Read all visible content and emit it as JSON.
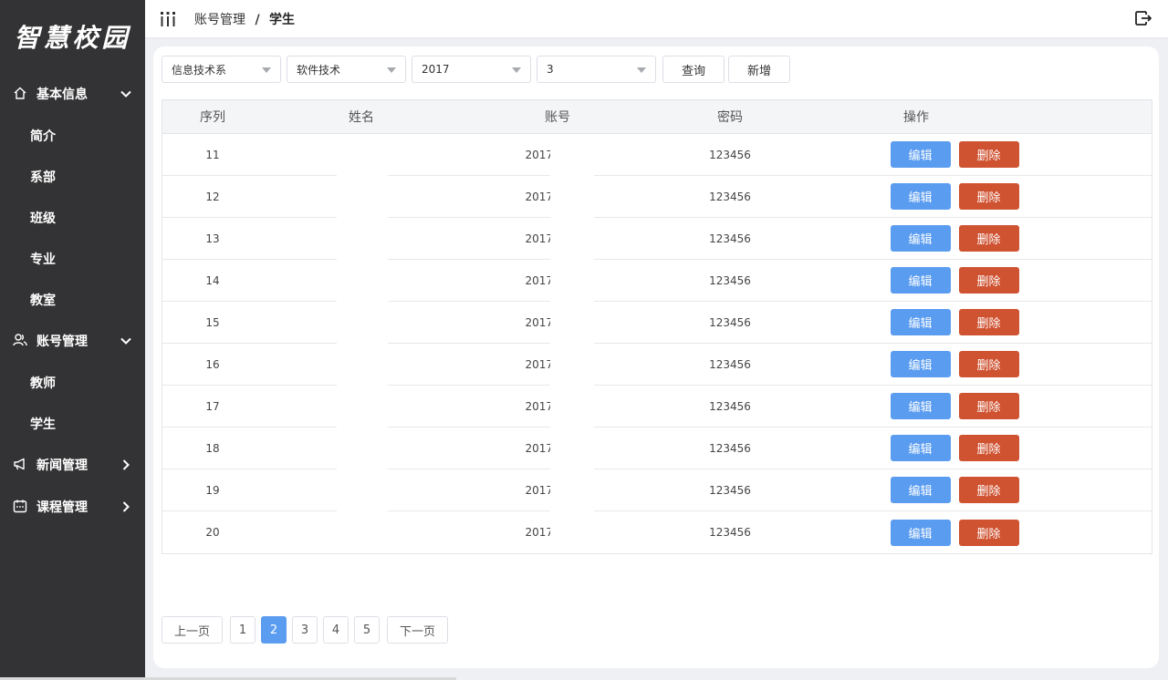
{
  "brand": {
    "logo_text": "智慧校园"
  },
  "sidebar": {
    "groups": [
      {
        "label": "基本信息",
        "icon": "home-icon",
        "expanded": true,
        "items": [
          "简介",
          "系部",
          "班级",
          "专业",
          "教室"
        ]
      },
      {
        "label": "账号管理",
        "icon": "users-icon",
        "expanded": true,
        "items": [
          "教师",
          "学生"
        ]
      },
      {
        "label": "新闻管理",
        "icon": "megaphone-icon",
        "expanded": false,
        "items": []
      },
      {
        "label": "课程管理",
        "icon": "calendar-icon",
        "expanded": false,
        "items": []
      }
    ]
  },
  "header": {
    "breadcrumb_parent": "账号管理",
    "breadcrumb_sep": "/",
    "breadcrumb_current": "学生",
    "menu_icon": "menu-icon",
    "logout_icon": "logout-icon"
  },
  "filters": {
    "department": "信息技术系",
    "major": "软件技术",
    "year": "2017",
    "class": "3",
    "query_label": "查询",
    "add_label": "新增"
  },
  "table": {
    "headers": {
      "index": "序列",
      "name": "姓名",
      "account": "账号",
      "password": "密码",
      "actions": "操作"
    },
    "edit_label": "编辑",
    "delete_label": "删除",
    "rows": [
      {
        "index": "11",
        "name": "",
        "account": "2017",
        "password": "123456"
      },
      {
        "index": "12",
        "name": "",
        "account": "2017",
        "password": "123456"
      },
      {
        "index": "13",
        "name": "",
        "account": "2017",
        "password": "123456"
      },
      {
        "index": "14",
        "name": "",
        "account": "2017",
        "password": "123456"
      },
      {
        "index": "15",
        "name": "",
        "account": "2017",
        "password": "123456"
      },
      {
        "index": "16",
        "name": "",
        "account": "2017",
        "password": "123456"
      },
      {
        "index": "17",
        "name": "",
        "account": "2017",
        "password": "123456"
      },
      {
        "index": "18",
        "name": "",
        "account": "2017",
        "password": "123456"
      },
      {
        "index": "19",
        "name": "",
        "account": "2017",
        "password": "123456"
      },
      {
        "index": "20",
        "name": "",
        "account": "2017",
        "password": "123456"
      }
    ]
  },
  "pagination": {
    "prev_label": "上一页",
    "next_label": "下一页",
    "pages": [
      "1",
      "2",
      "3",
      "4",
      "5"
    ],
    "current": "2"
  },
  "colors": {
    "sidebar_bg": "#333335",
    "primary": "#5a9cf0",
    "danger": "#cf5231"
  }
}
